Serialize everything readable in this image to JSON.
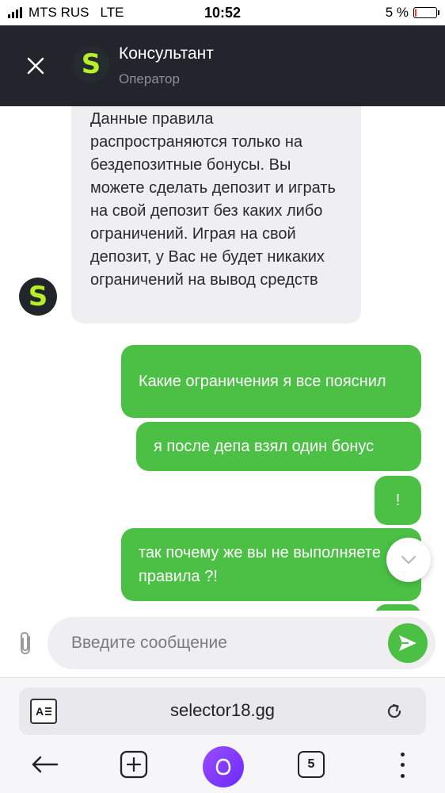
{
  "status_bar": {
    "carrier": "MTS RUS",
    "network": "LTE",
    "time": "10:52",
    "battery_percent": "5 %",
    "battery_level": 0.05
  },
  "header": {
    "avatar_letter": "S",
    "title": "Консультант",
    "subtitle": "Оператор"
  },
  "messages": {
    "incoming": [
      {
        "text": "Данные правила распространяются только на бездепозитные бонусы. Вы можете сделать депозит и играть на свой депозит без каких либо ограничений. Играя на свой депозит, у Вас не будет никаких ограничений на вывод средств",
        "avatar_letter": "S"
      }
    ],
    "outgoing": [
      {
        "text": "Какие ограничения я все пояснил"
      },
      {
        "text": "я после депа взял один бонус"
      },
      {
        "text": "!"
      },
      {
        "text": "так почему же вы не выполняете правила ?!"
      },
      {
        "text": ""
      }
    ]
  },
  "composer": {
    "placeholder": "Введите сообщение"
  },
  "browser": {
    "url": "selector18.gg",
    "reader_label": "A",
    "tab_count": "5"
  },
  "colors": {
    "header_bg": "#22262c",
    "accent_green": "#4bc045",
    "logo_green": "#b6ee29",
    "incoming_bg": "#efeff1"
  }
}
